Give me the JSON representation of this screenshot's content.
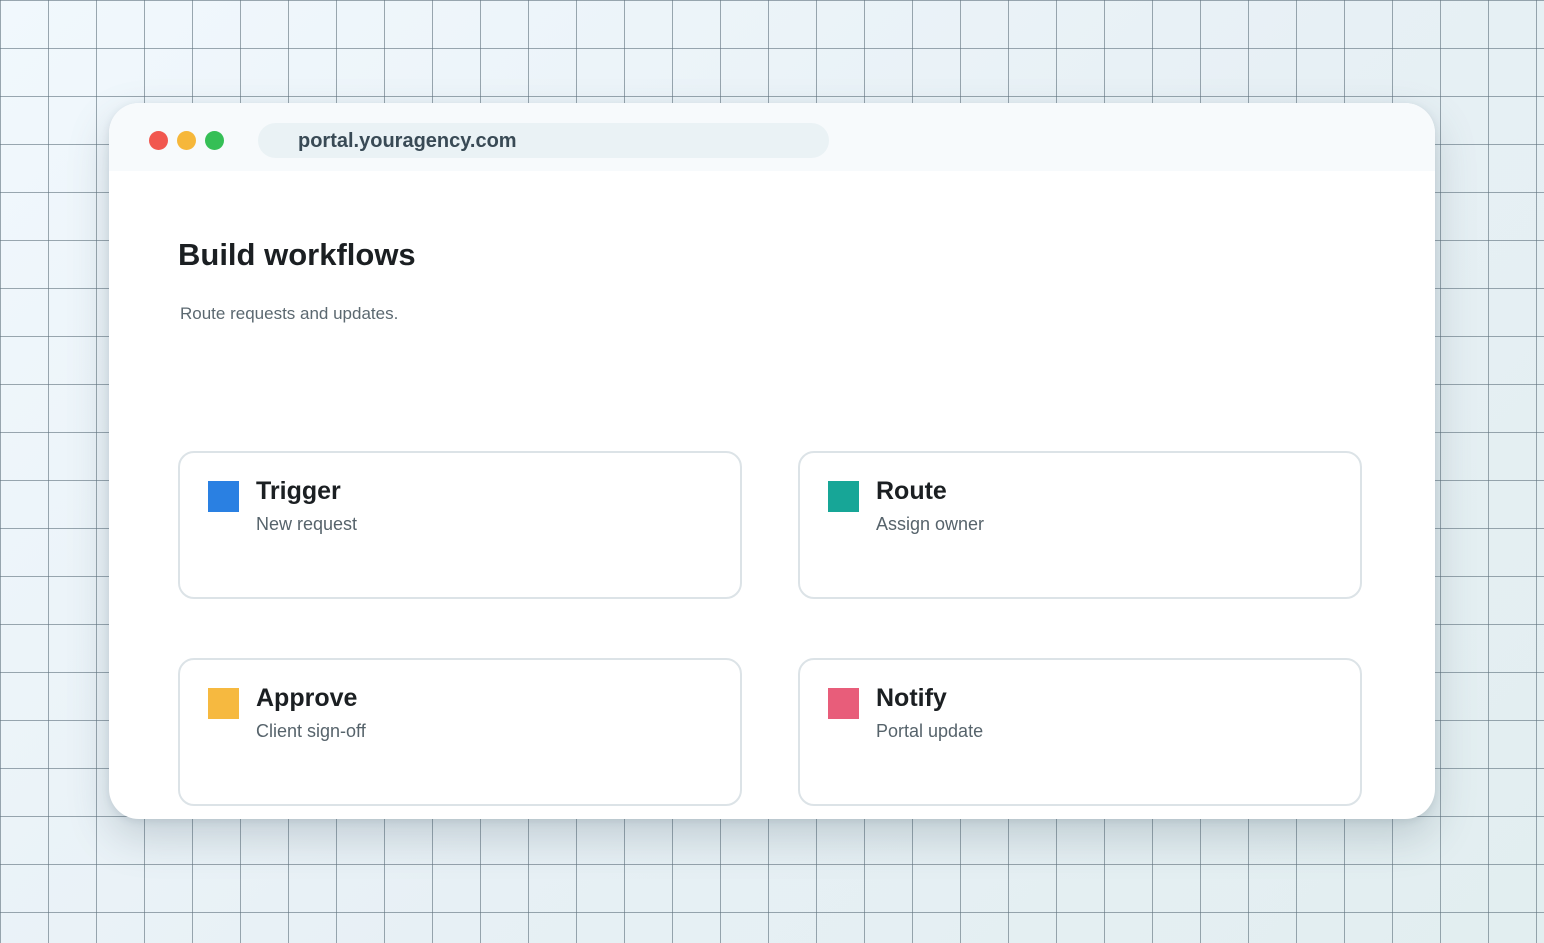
{
  "browser": {
    "url": "portal.youragency.com"
  },
  "page": {
    "title": "Build workflows",
    "subtitle": "Route requests and updates."
  },
  "cards": [
    {
      "title": "Trigger",
      "description": "New request",
      "icon": "blue-square-icon",
      "color": "#2a80e2"
    },
    {
      "title": "Route",
      "description": "Assign owner",
      "icon": "teal-square-icon",
      "color": "#17a697"
    },
    {
      "title": "Approve",
      "description": "Client sign-off",
      "icon": "yellow-square-icon",
      "color": "#f6b940"
    },
    {
      "title": "Notify",
      "description": "Portal update",
      "icon": "pink-square-icon",
      "color": "#e85d7a"
    }
  ],
  "colors": {
    "close": "#f1574f",
    "minimize": "#f6b73a",
    "maximize": "#35bf56"
  }
}
